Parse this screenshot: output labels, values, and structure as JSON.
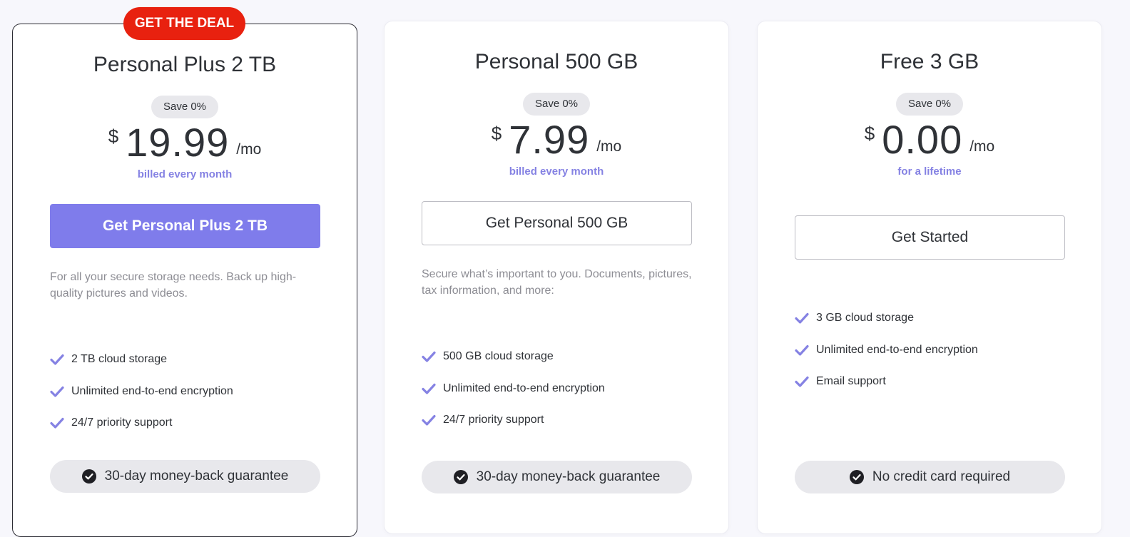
{
  "deal_badge": "GET THE DEAL",
  "plans": [
    {
      "name": "Personal Plus 2 TB",
      "save": "Save 0%",
      "currency": "$",
      "amount": "19.99",
      "period": "/mo",
      "billing": "billed every month",
      "cta": "Get Personal Plus 2 TB",
      "description": "For all your secure storage needs. Back up high-quality pictures and videos.",
      "features": [
        "2 TB cloud storage",
        "Unlimited end-to-end encryption",
        "24/7 priority support"
      ],
      "guarantee": "30-day money-back guarantee"
    },
    {
      "name": "Personal 500 GB",
      "save": "Save 0%",
      "currency": "$",
      "amount": "7.99",
      "period": "/mo",
      "billing": "billed every month",
      "cta": "Get Personal 500 GB",
      "description": "Secure what’s important to you. Documents, pictures, tax information, and more:",
      "features": [
        "500 GB cloud storage",
        "Unlimited end-to-end encryption",
        "24/7 priority support"
      ],
      "guarantee": "30-day money-back guarantee"
    },
    {
      "name": "Free 3 GB",
      "save": "Save 0%",
      "currency": "$",
      "amount": "0.00",
      "period": "/mo",
      "billing": "for a lifetime",
      "cta": "Get Started",
      "features": [
        "3 GB cloud storage",
        "Unlimited end-to-end encryption",
        "Email support"
      ],
      "guarantee": "No credit card required"
    }
  ],
  "colors": {
    "accent": "#7f7ceb",
    "deal": "#e8210f",
    "billing_text": "#8582e3",
    "check": "#8582e3"
  },
  "icons": {
    "feature": "checkmark-icon",
    "guarantee": "check-circle-icon"
  }
}
